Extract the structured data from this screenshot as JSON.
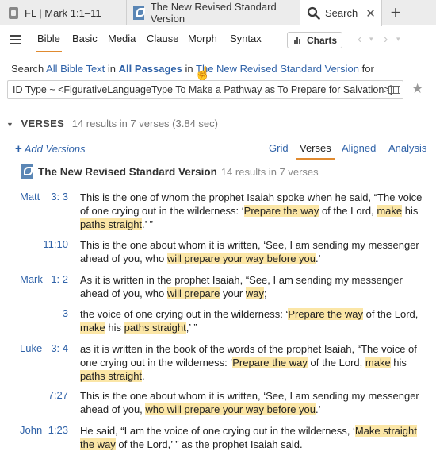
{
  "tabs": [
    {
      "label": "FL | Mark 1:1–11",
      "icon": "document-icon"
    },
    {
      "label": "The New Revised Standard Version",
      "icon": "nrsv-book-icon"
    },
    {
      "label": "Search",
      "icon": "search-icon",
      "close": "✕"
    }
  ],
  "tab_add": "+",
  "toolbar": {
    "tabs": [
      "Bible",
      "Basic",
      "Media",
      "Clause",
      "Morph",
      "Syntax"
    ],
    "active": "Bible",
    "charts_label": "Charts"
  },
  "search": {
    "prefix": "Search",
    "scope": "All Bible Text",
    "in1": "in",
    "passages": "All Passages",
    "in2": "in",
    "version": "The New Revised Standard Version",
    "for": "for",
    "query": "ID Type ~ <FigurativeLanguageType To Make a Pathway as To Prepare for Salvation>]"
  },
  "results": {
    "section_title": "VERSES",
    "summary": "14 results in 7 verses (3.84 sec)",
    "add_versions": "Add Versions",
    "add_plus": "+",
    "views": [
      "Grid",
      "Verses",
      "Aligned",
      "Analysis"
    ],
    "active_view": "Verses",
    "version_name": "The New Revised Standard Version",
    "version_meta": "14 results in 7 verses"
  },
  "verses": [
    {
      "book": "Matt",
      "ref": "3: 3",
      "segments": [
        {
          "t": "This is the one of whom the prophet Isaiah spoke when he said, “The voice of one crying out in the wilderness: ‘",
          "h": false
        },
        {
          "t": "Prepare the way",
          "h": true
        },
        {
          "t": " of the Lord, ",
          "h": false
        },
        {
          "t": "make",
          "h": true
        },
        {
          "t": " his ",
          "h": false
        },
        {
          "t": "paths straight",
          "h": true
        },
        {
          "t": ".’ ”",
          "h": false
        }
      ]
    },
    {
      "book": "",
      "ref": "11:10",
      "segments": [
        {
          "t": "This is the one about whom it is written, ‘See, I am sending my messenger ahead of you, who ",
          "h": false
        },
        {
          "t": "will prepare your way before you",
          "h": true
        },
        {
          "t": ".’",
          "h": false
        }
      ]
    },
    {
      "book": "Mark",
      "ref": "1: 2",
      "segments": [
        {
          "t": "As it is written in the prophet Isaiah, “See, I am sending my messenger ahead of you, who ",
          "h": false
        },
        {
          "t": "will prepare",
          "h": true
        },
        {
          "t": " your ",
          "h": false
        },
        {
          "t": "way",
          "h": true
        },
        {
          "t": ";",
          "h": false
        }
      ]
    },
    {
      "book": "",
      "ref": "3",
      "segments": [
        {
          "t": "the voice of one crying out in the wilderness: ‘",
          "h": false
        },
        {
          "t": "Prepare the way",
          "h": true
        },
        {
          "t": " of the Lord, ",
          "h": false
        },
        {
          "t": "make",
          "h": true
        },
        {
          "t": " his ",
          "h": false
        },
        {
          "t": "paths straight",
          "h": true
        },
        {
          "t": ",’ ”",
          "h": false
        }
      ]
    },
    {
      "book": "Luke",
      "ref": "3: 4",
      "segments": [
        {
          "t": "as it is written in the book of the words of the prophet Isaiah, “The voice of one crying out in the wilderness: ‘",
          "h": false
        },
        {
          "t": "Prepare the way",
          "h": true
        },
        {
          "t": " of the Lord, ",
          "h": false
        },
        {
          "t": "make",
          "h": true
        },
        {
          "t": " his ",
          "h": false
        },
        {
          "t": "paths straight",
          "h": true
        },
        {
          "t": ".",
          "h": false
        }
      ]
    },
    {
      "book": "",
      "ref": "7:27",
      "segments": [
        {
          "t": "This is the one about whom it is written, ‘See, I am sending my messenger ahead of you, ",
          "h": false
        },
        {
          "t": "who will prepare your way before you",
          "h": true
        },
        {
          "t": ".’",
          "h": false
        }
      ]
    },
    {
      "book": "John",
      "ref": "1:23",
      "segments": [
        {
          "t": "He said, “I am the voice of one crying out in the wilderness, ‘",
          "h": false
        },
        {
          "t": "Make straight the way",
          "h": true
        },
        {
          "t": " of the Lord,’ ” as the prophet Isaiah said.",
          "h": false
        }
      ]
    }
  ],
  "colors": {
    "accent": "#e08a2f",
    "link": "#2f62a8",
    "highlight": "#fbe6a6"
  }
}
